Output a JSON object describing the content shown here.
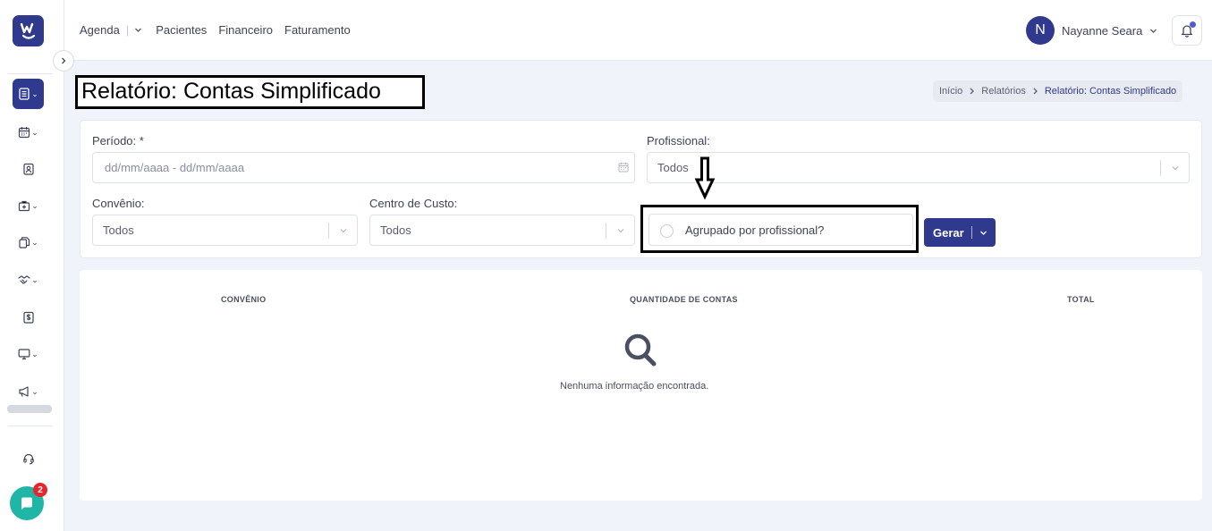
{
  "topnav": {
    "agenda": "Agenda",
    "pacientes": "Pacientes",
    "financeiro": "Financeiro",
    "faturamento": "Faturamento"
  },
  "user": {
    "initial": "N",
    "name": "Nayanne Seara"
  },
  "page": {
    "title": "Relatório: Contas Simplificado"
  },
  "breadcrumb": {
    "items": [
      "Início",
      "Relatórios",
      "Relatório: Contas Simplificado"
    ]
  },
  "filters": {
    "periodo_label": "Período: *",
    "periodo_placeholder": "dd/mm/aaaa - dd/mm/aaaa",
    "profissional_label": "Profissional:",
    "profissional_value": "Todos",
    "convenio_label": "Convênio:",
    "convenio_value": "Todos",
    "centro_label": "Centro de Custo:",
    "centro_value": "Todos",
    "agrupado_label": "Agrupado por profissional?",
    "agrupado_checked": false,
    "gerar_label": "Gerar"
  },
  "table": {
    "columns": [
      "CONVÊNIO",
      "QUANTIDADE DE CONTAS",
      "TOTAL"
    ],
    "empty_message": "Nenhuma informação encontrada."
  },
  "chat": {
    "badge_count": "2"
  },
  "colors": {
    "primary": "#2f3a8f",
    "chat": "#1fb6a6",
    "badge": "#e5262e",
    "background": "#f1f3fa"
  },
  "icons": {
    "sidebar": [
      "report-icon",
      "calendar-icon",
      "patient-card-icon",
      "medical-bag-icon",
      "documents-icon",
      "handshake-icon",
      "dollar-icon",
      "monitor-icon",
      "megaphone-icon",
      "headset-icon"
    ]
  }
}
